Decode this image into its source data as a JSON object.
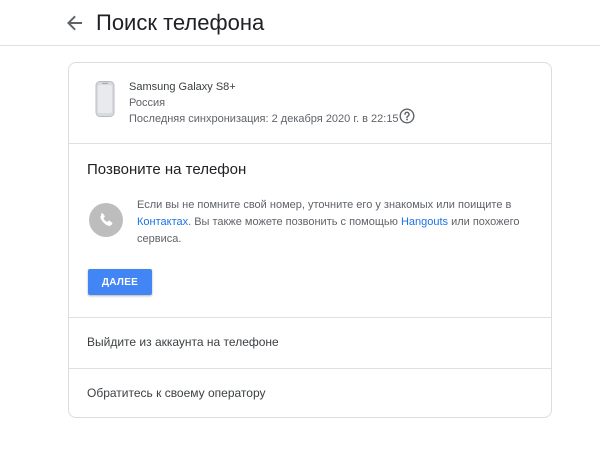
{
  "header": {
    "title": "Поиск телефона",
    "back_icon": "arrow-left-icon"
  },
  "device": {
    "name": "Samsung Galaxy S8+",
    "country": "Россия",
    "last_sync": "Последняя синхронизация: 2 декабря 2020 г. в 22:15",
    "help_icon": "help-circle-icon"
  },
  "call_section": {
    "title": "Позвоните на телефон",
    "icon": "phone-icon",
    "desc_part1": "Если вы не помните свой номер, уточните его у знакомых или поищите в ",
    "contacts_link": "Контактах",
    "desc_part2": ". Вы также можете позвонить с помощью ",
    "hangouts_link": "Hangouts",
    "desc_part3": " или похожего сервиса.",
    "next_button": "ДАЛЕЕ"
  },
  "sign_out_row": {
    "label": "Выйдите из аккаунта на телефоне"
  },
  "operator_row": {
    "label": "Обратитесь к своему оператору"
  },
  "colors": {
    "accent": "#4285f4",
    "link": "#1a73e8",
    "text_primary": "#202124",
    "text_secondary": "#5f6368",
    "border": "#dadce0"
  }
}
